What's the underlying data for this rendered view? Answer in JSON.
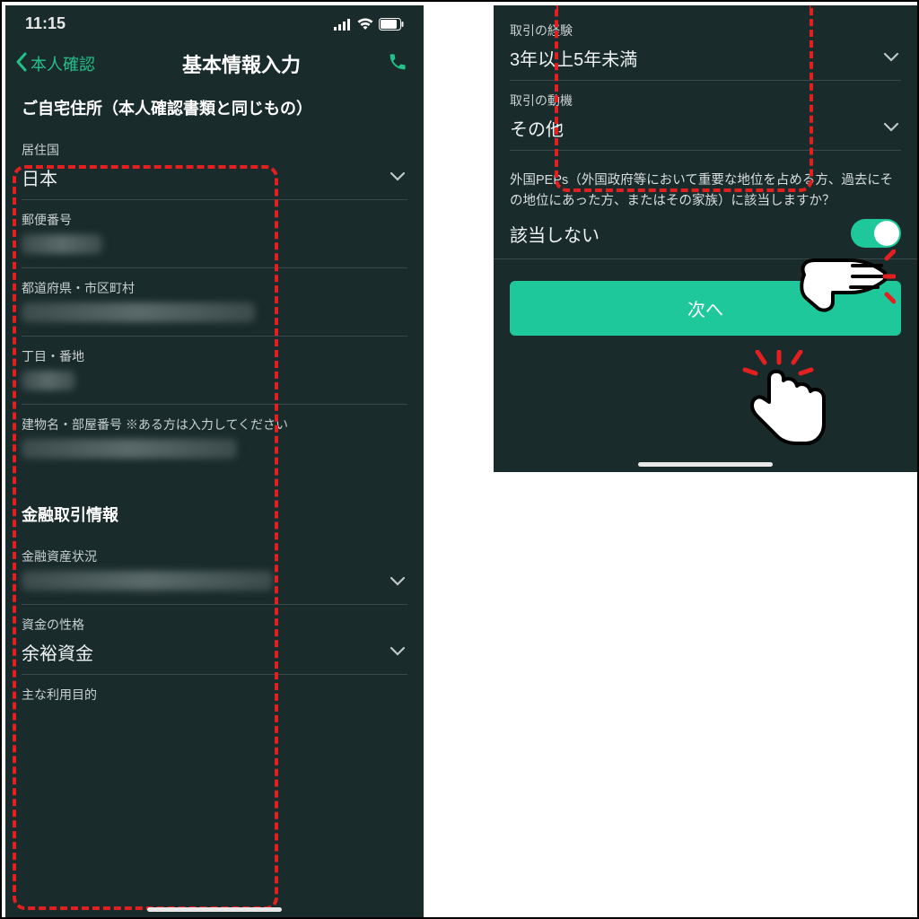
{
  "status": {
    "time": "11:15"
  },
  "nav": {
    "back": "本人確認",
    "title": "基本情報入力"
  },
  "left": {
    "address_heading": "ご自宅住所（本人確認書類と同じもの）",
    "fields": {
      "country_label": "居住国",
      "country_value": "日本",
      "postal_label": "郵便番号",
      "pref_label": "都道府県・市区町村",
      "block_label": "丁目・番地",
      "building_label": "建物名・部屋番号 ※ある方は入力してください"
    },
    "finance_heading": "金融取引情報",
    "finance": {
      "assets_label": "金融資産状況",
      "nature_label": "資金の性格",
      "nature_value": "余裕資金",
      "purpose_label": "主な利用目的"
    }
  },
  "right": {
    "experience_label": "取引の経験",
    "experience_value": "3年以上5年未満",
    "motive_label": "取引の動機",
    "motive_value": "その他",
    "peps_question": "外国PEPs（外国政府等において重要な地位を占める方、過去にその地位にあった方、またはその家族）に該当しますか？",
    "peps_value": "該当しない",
    "next_button": "次へ"
  }
}
